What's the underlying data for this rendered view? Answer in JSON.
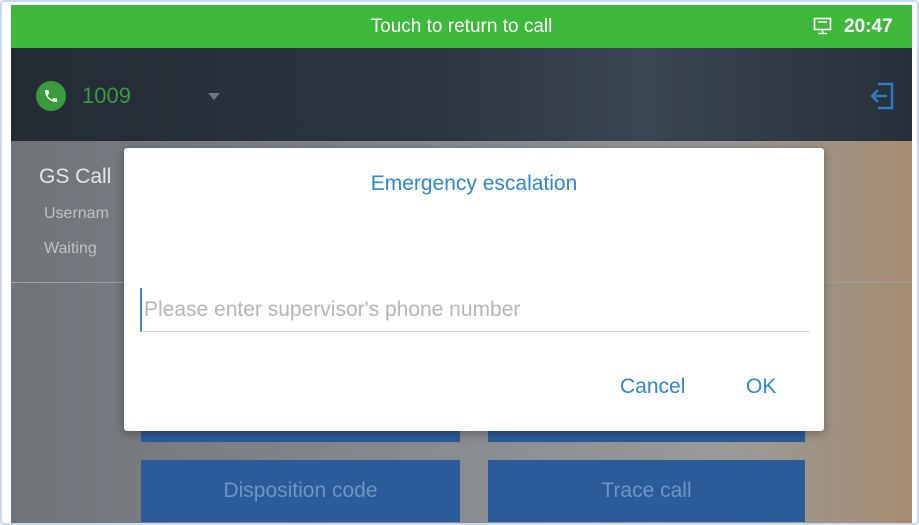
{
  "status_bar": {
    "call_banner": "Touch to return to call",
    "time": "20:47",
    "sim_icon": "sim-card-icon",
    "background_color": "#3eb83a"
  },
  "app_header": {
    "account_number": "1009",
    "account_icon": "phone-icon",
    "dropdown_icon": "chevron-down-icon",
    "logout_icon": "logout-icon",
    "account_color": "#3d9a43"
  },
  "background_panel": {
    "title": "GS Call",
    "username_label": "Usernam",
    "waiting_label": "Waiting",
    "buttons": [
      {
        "label": ""
      },
      {
        "label": ""
      },
      {
        "label": "Disposition code"
      },
      {
        "label": "Trace call"
      }
    ]
  },
  "dialog": {
    "title": "Emergency escalation",
    "phone_input": {
      "value": "",
      "placeholder": "Please enter supervisor's phone number"
    },
    "cancel_label": "Cancel",
    "ok_label": "OK",
    "accent_color": "#2f86d4"
  }
}
